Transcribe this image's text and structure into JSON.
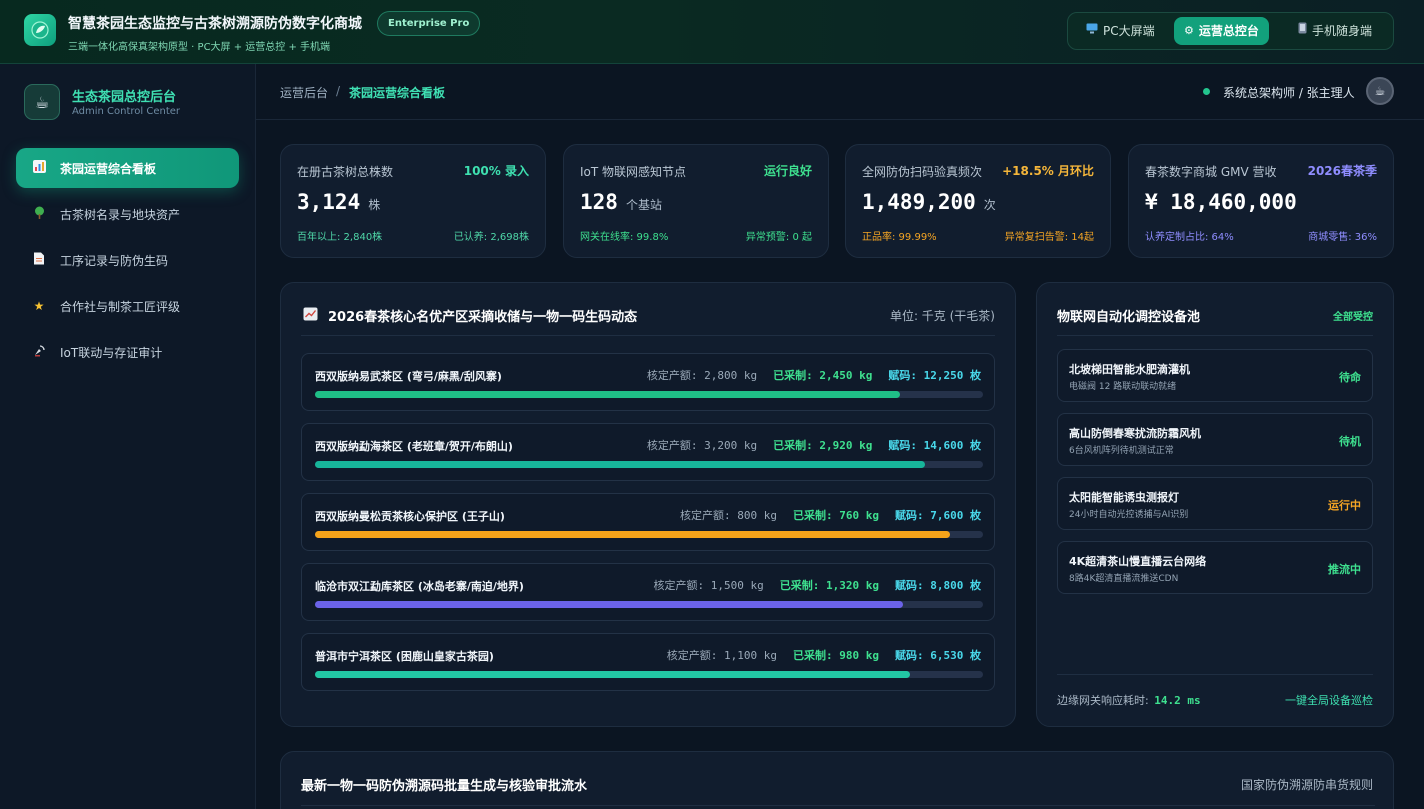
{
  "header": {
    "title": "智慧茶园生态监控与古茶树溯源防伪数字化商城",
    "edition_badge": "Enterprise Pro",
    "subtitle": "三端一体化高保真架构原型 · PC大屏 + 运营总控 + 手机端",
    "logo_icon": "leaf-icon",
    "segments": [
      {
        "label": "PC大屏端",
        "icon": "monitor-icon",
        "active": false
      },
      {
        "label": "运营总控台",
        "icon": "gear-icon",
        "active": true
      },
      {
        "label": "手机随身端",
        "icon": "phone-icon",
        "active": false
      }
    ]
  },
  "sidebar": {
    "title": "生态茶园总控后台",
    "subtitle": "Admin Control Center",
    "logo_icon": "teacup-icon",
    "items": [
      {
        "label": "茶园运营综合看板",
        "icon": "chart-icon",
        "active": true
      },
      {
        "label": "古茶树名录与地块资产",
        "icon": "tree-icon",
        "active": false
      },
      {
        "label": "工序记录与防伪生码",
        "icon": "document-icon",
        "active": false
      },
      {
        "label": "合作社与制茶工匠评级",
        "icon": "star-icon",
        "active": false
      },
      {
        "label": "IoT联动与存证审计",
        "icon": "satellite-icon",
        "active": false
      }
    ]
  },
  "breadcrumb": {
    "root": "运营后台",
    "separator": "/",
    "current": "茶园运营综合看板"
  },
  "user": {
    "name": "系统总架构师 / 张主理人",
    "status_color": "#23c58e",
    "avatar_icon": "avatar-icon"
  },
  "kpis": [
    {
      "label": "在册古茶树总株数",
      "tag": "100% 录入",
      "tag_color": "#3ee0b0",
      "value": "3,124",
      "unit": "株",
      "foot_left": "百年以上: 2,840株",
      "foot_right": "已认养: 2,698株",
      "foot_color": "#4fd7a8"
    },
    {
      "label": "IoT 物联网感知节点",
      "tag": "运行良好",
      "tag_color": "#3ee08f",
      "value": "128",
      "unit": "个基站",
      "foot_left": "网关在线率: 99.8%",
      "foot_right": "异常预警: 0 起",
      "foot_color": "#3ee08f"
    },
    {
      "label": "全网防伪扫码验真频次",
      "tag": "+18.5% 月环比",
      "tag_color": "#f5b63a",
      "value": "1,489,200",
      "unit": "次",
      "foot_left": "正品率: 99.99%",
      "foot_right": "异常复扫告警: 14起",
      "foot_color": "#f5a524"
    },
    {
      "label": "春茶数字商城 GMV 营收",
      "tag": "2026春茶季",
      "tag_color": "#8f8dff",
      "value": "¥ 18,460,000",
      "unit": "",
      "foot_left": "认养定制占比: 64%",
      "foot_right": "商城零售: 36%",
      "foot_color": "#8f8dff"
    }
  ],
  "harvest": {
    "title": "2026春茶核心名优产区采摘收储与一物一码生码动态",
    "title_icon": "trend-chart-icon",
    "unit": "单位: 千克 (干毛茶)",
    "quota_label": "核定产额:",
    "picked_label": "已采制:",
    "code_label": "赋码:",
    "zones": [
      {
        "name": "西双版纳易武茶区 (弯弓/麻黑/刮风寨)",
        "quota": "2,800 kg",
        "picked": "2,450 kg",
        "codes": "12,250 枚",
        "progress": 0.875,
        "color": "#1fbf87"
      },
      {
        "name": "西双版纳勐海茶区 (老班章/贺开/布朗山)",
        "quota": "3,200 kg",
        "picked": "2,920 kg",
        "codes": "14,600 枚",
        "progress": 0.9125,
        "color": "#17b59a"
      },
      {
        "name": "西双版纳曼松贡茶核心保护区 (王子山)",
        "quota": "800 kg",
        "picked": "760 kg",
        "codes": "7,600 枚",
        "progress": 0.95,
        "color": "#f5a31a"
      },
      {
        "name": "临沧市双江勐库茶区 (冰岛老寨/南迫/地界)",
        "quota": "1,500 kg",
        "picked": "1,320 kg",
        "codes": "8,800 枚",
        "progress": 0.88,
        "color": "#6b63e8"
      },
      {
        "name": "普洱市宁洱茶区 (困鹿山皇家古茶园)",
        "quota": "1,100 kg",
        "picked": "980 kg",
        "codes": "6,530 枚",
        "progress": 0.89,
        "color": "#22c7a4"
      }
    ]
  },
  "devices": {
    "title": "物联网自动化调控设备池",
    "status_all": "全部受控",
    "items": [
      {
        "name": "北坡梯田智能水肥滴灌机",
        "desc": "电磁阀 12 路联动联动就绪",
        "state": "待命",
        "state_color": "#3ee08f"
      },
      {
        "name": "高山防倒春寒扰流防霜风机",
        "desc": "6台风机阵列待机测试正常",
        "state": "待机",
        "state_color": "#3ee08f"
      },
      {
        "name": "太阳能智能诱虫测报灯",
        "desc": "24小时自动光控诱捕与AI识别",
        "state": "运行中",
        "state_color": "#f5a524"
      },
      {
        "name": "4K超清茶山慢直播云台网络",
        "desc": "8路4K超清直播流推送CDN",
        "state": "推流中",
        "state_color": "#3ee08f"
      }
    ],
    "latency_label": "边缘网关响应耗时:",
    "latency_value": "14.2 ms",
    "inspect_link": "一键全局设备巡检"
  },
  "batch": {
    "title": "最新一物一码防伪溯源码批量生成与核验审批流水",
    "rules_link": "国家防伪溯源防串货规则"
  }
}
